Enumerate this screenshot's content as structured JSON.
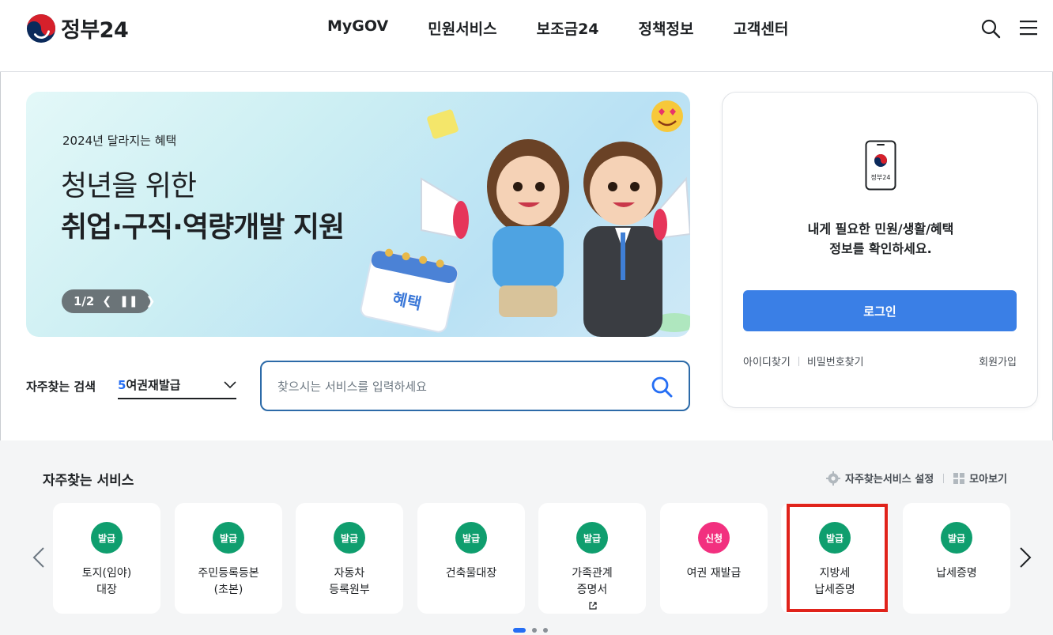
{
  "header": {
    "logo_text": "정부24",
    "nav": [
      "MyGOV",
      "민원서비스",
      "보조금24",
      "정책정보",
      "고객센터"
    ]
  },
  "banner": {
    "eyebrow": "2024년 달라지는 혜택",
    "title_line1": "청년을 위한",
    "title_line2": "취업·구직·역량개발 지원",
    "page_indicator": "1/2",
    "calendar_text": "혜택"
  },
  "login_card": {
    "app_label": "정부24",
    "message_line1": "내게 필요한 민원/생활/혜택",
    "message_line2": "정보를 확인하세요.",
    "login_button": "로그인",
    "find_id": "아이디찾기",
    "find_password": "비밀번호찾기",
    "signup": "회원가입"
  },
  "frequent_search": {
    "label": "자주찾는 검색",
    "selected_rank": "5",
    "selected_text": "여권재발급"
  },
  "search": {
    "placeholder": "찾으시는 서비스를 입력하세요"
  },
  "services": {
    "title": "자주찾는 서비스",
    "settings_label": "자주찾는서비스 설정",
    "view_all_label": "모아보기",
    "badge_colors": {
      "발급": "#0f9e6e",
      "신청": "#f2307f"
    },
    "items": [
      {
        "badge": "발급",
        "line1": "토지(임야)",
        "line2": "대장"
      },
      {
        "badge": "발급",
        "line1": "주민등록등본",
        "line2": "(초본)"
      },
      {
        "badge": "발급",
        "line1": "자동차",
        "line2": "등록원부"
      },
      {
        "badge": "발급",
        "line1": "건축물대장",
        "line2": ""
      },
      {
        "badge": "발급",
        "line1": "가족관계",
        "line2": "증명서"
      },
      {
        "badge": "신청",
        "line1": "여권 재발급",
        "line2": ""
      },
      {
        "badge": "발급",
        "line1": "지방세",
        "line2": "납세증명"
      },
      {
        "badge": "발급",
        "line1": "납세증명",
        "line2": ""
      }
    ],
    "highlighted_item": "지방세 납세증명",
    "carousel_pages": 3,
    "current_page": 1
  }
}
